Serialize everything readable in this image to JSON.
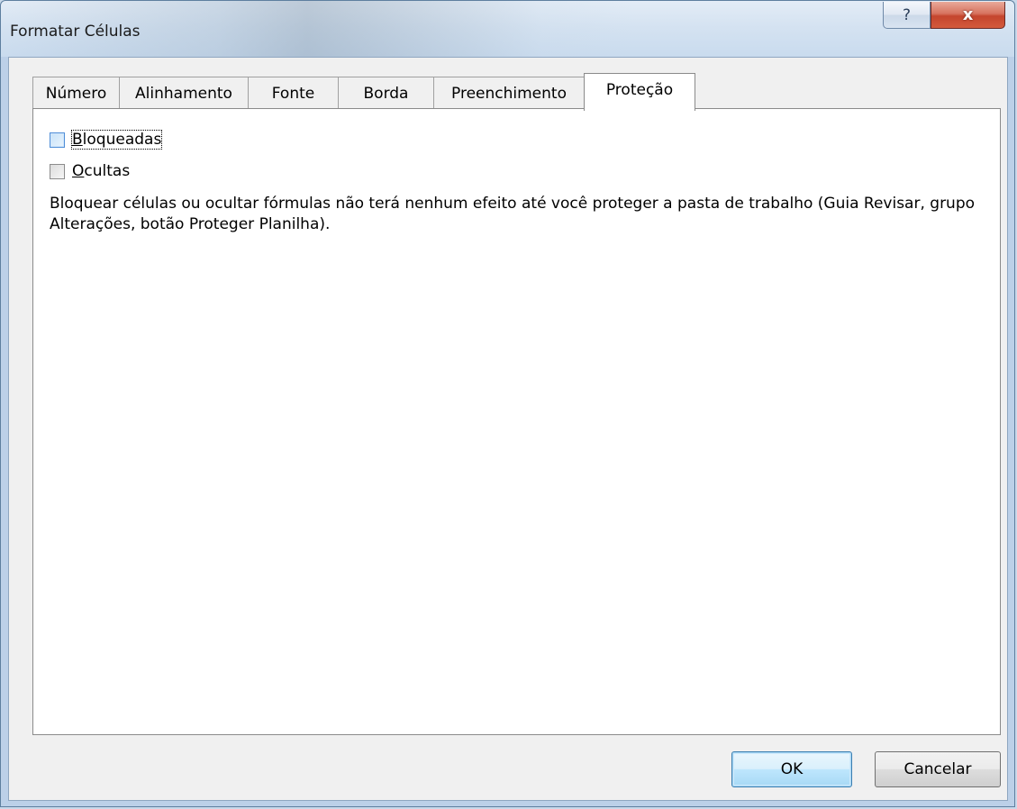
{
  "window": {
    "title": "Formatar Células",
    "help_label": "?",
    "close_label": "x"
  },
  "tabs": [
    {
      "label": "Número",
      "active": false
    },
    {
      "label": "Alinhamento",
      "active": false
    },
    {
      "label": "Fonte",
      "active": false
    },
    {
      "label": "Borda",
      "active": false
    },
    {
      "label": "Preenchimento",
      "active": false
    },
    {
      "label": "Proteção",
      "active": true
    }
  ],
  "protection": {
    "locked": {
      "accel": "B",
      "rest": "loqueadas",
      "checked": false
    },
    "hidden": {
      "accel": "O",
      "rest": "cultas",
      "checked": false
    },
    "note": "Bloquear células ou ocultar fórmulas não terá nenhum efeito até você proteger a pasta de trabalho (Guia Revisar, grupo Alterações, botão Proteger Planilha)."
  },
  "buttons": {
    "ok": "OK",
    "cancel": "Cancelar"
  }
}
